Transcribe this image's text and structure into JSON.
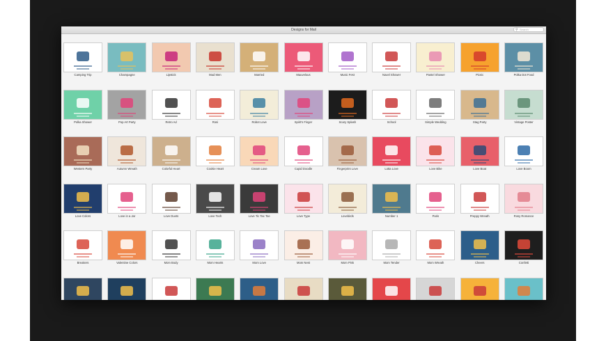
{
  "window": {
    "title": "Designs for Mail",
    "search_placeholder": "Search"
  },
  "templates": [
    {
      "name": "Camping Trip",
      "bg": "#ffffff",
      "accent": "#2e5c88"
    },
    {
      "name": "Champagne",
      "bg": "#79bcc0",
      "accent": "#e8c25a"
    },
    {
      "name": "Lipstick",
      "bg": "#f2c9b0",
      "accent": "#c7247a"
    },
    {
      "name": "Mad Men",
      "bg": "#e9e0cf",
      "accent": "#c8342b"
    },
    {
      "name": "Married",
      "bg": "#d4b078",
      "accent": "#ffffff"
    },
    {
      "name": "Mauvelous",
      "bg": "#ec5a78",
      "accent": "#ffffff"
    },
    {
      "name": "Music Fest",
      "bg": "#ffffff",
      "accent": "#a25cc7"
    },
    {
      "name": "Navel Shower",
      "bg": "#ffffff",
      "accent": "#c93a3a"
    },
    {
      "name": "Pastel Shower",
      "bg": "#f8efd0",
      "accent": "#e88bb0"
    },
    {
      "name": "Picnic",
      "bg": "#f6a22e",
      "accent": "#d33a2c"
    },
    {
      "name": "Polka Dot Food",
      "bg": "#5c8fa6",
      "accent": "#f2e9d6"
    },
    {
      "name": "Polka Shower",
      "bg": "#6fd1a8",
      "accent": "#ffffff"
    },
    {
      "name": "Pop Art Party",
      "bg": "#a3a3a3",
      "accent": "#e0447a"
    },
    {
      "name": "Retro Ad",
      "bg": "#ffffff",
      "accent": "#333333"
    },
    {
      "name": "Rosi",
      "bg": "#ffffff",
      "accent": "#d7483a"
    },
    {
      "name": "Robot Love",
      "bg": "#f3edd9",
      "accent": "#3c7fa0"
    },
    {
      "name": "Spirit's Finger",
      "bg": "#b8a1c6",
      "accent": "#e0447a"
    },
    {
      "name": "Scary Splash",
      "bg": "#1c1c1c",
      "accent": "#e26a1f"
    },
    {
      "name": "School",
      "bg": "#ffffff",
      "accent": "#c93a3a"
    },
    {
      "name": "Simple Wedding",
      "bg": "#ffffff",
      "accent": "#666666"
    },
    {
      "name": "Stag Party",
      "bg": "#d8b88c",
      "accent": "#3c6e95"
    },
    {
      "name": "Vintage Poster",
      "bg": "#c6ddd0",
      "accent": "#5a8a6e"
    },
    {
      "name": "Western Party",
      "bg": "#a96b58",
      "accent": "#f3e1c2"
    },
    {
      "name": "Autumn Wreath",
      "bg": "#efe6db",
      "accent": "#b0572c"
    },
    {
      "name": "Colorful Heart",
      "bg": "#cdb08d",
      "accent": "#ffffff"
    },
    {
      "name": "Cookie Heart",
      "bg": "#ffffff",
      "accent": "#e27d3a"
    },
    {
      "name": "Cream Love",
      "bg": "#f9d8b8",
      "accent": "#e0447a"
    },
    {
      "name": "Cupid Doodle",
      "bg": "#ffffff",
      "accent": "#e0447a"
    },
    {
      "name": "Fingerprint Love",
      "bg": "#d9c2ae",
      "accent": "#9a5b3a"
    },
    {
      "name": "Lotta Love",
      "bg": "#e84a5f",
      "accent": "#ffffff"
    },
    {
      "name": "Love Bike",
      "bg": "#fbe3ea",
      "accent": "#d7483a"
    },
    {
      "name": "Love Boat",
      "bg": "#e8606a",
      "accent": "#2d4a76"
    },
    {
      "name": "Love Boom",
      "bg": "#ffffff",
      "accent": "#2d6aa6"
    },
    {
      "name": "Love Colors",
      "bg": "#213e6d",
      "accent": "#f2c04a"
    },
    {
      "name": "Love in a Jar",
      "bg": "#ffffff",
      "accent": "#e0447a"
    },
    {
      "name": "Love Duets",
      "bg": "#ffffff",
      "accent": "#5c3c2c"
    },
    {
      "name": "Love Tech",
      "bg": "#4a4a4a",
      "accent": "#ffffff"
    },
    {
      "name": "Love Tic Tac Toe",
      "bg": "#3a3a3a",
      "accent": "#e0447a"
    },
    {
      "name": "Love Type",
      "bg": "#fbe3ea",
      "accent": "#c93a3a"
    },
    {
      "name": "Lovebirds",
      "bg": "#f3ecd9",
      "accent": "#8a5b3a"
    },
    {
      "name": "Number 1",
      "bg": "#4f7a8e",
      "accent": "#f2c04a"
    },
    {
      "name": "Paris",
      "bg": "#ffffff",
      "accent": "#e0447a"
    },
    {
      "name": "Preppy Wreath",
      "bg": "#ffffff",
      "accent": "#c93a3a"
    },
    {
      "name": "Rosy Romance",
      "bg": "#f9dadf",
      "accent": "#e27d8a"
    },
    {
      "name": "Breakers",
      "bg": "#ffffff",
      "accent": "#d7483a"
    },
    {
      "name": "Valentine Colors",
      "bg": "#f08a50",
      "accent": "#ffffff"
    },
    {
      "name": "Mom Body",
      "bg": "#ffffff",
      "accent": "#333333"
    },
    {
      "name": "Mom Hearts",
      "bg": "#ffffff",
      "accent": "#3aa58a"
    },
    {
      "name": "Mom Love",
      "bg": "#ffffff",
      "accent": "#8a6cc0"
    },
    {
      "name": "Mom Nest",
      "bg": "#fbeee6",
      "accent": "#9a5b3a"
    },
    {
      "name": "Mom Pink",
      "bg": "#f2b8c2",
      "accent": "#ffffff"
    },
    {
      "name": "Mom Tender",
      "bg": "#ffffff",
      "accent": "#aaaaaa"
    },
    {
      "name": "Mom Wreath",
      "bg": "#ffffff",
      "accent": "#d7483a"
    },
    {
      "name": "Cheers",
      "bg": "#2c5e8a",
      "accent": "#f2c04a"
    },
    {
      "name": "Confetti",
      "bg": "#1e1e1e",
      "accent": "#e24a3a"
    },
    {
      "name": "",
      "bg": "#2f4660",
      "accent": "#f2c04a"
    },
    {
      "name": "",
      "bg": "#1f3f5e",
      "accent": "#f2c04a"
    },
    {
      "name": "",
      "bg": "#ffffff",
      "accent": "#c93a3a"
    },
    {
      "name": "",
      "bg": "#3c7a52",
      "accent": "#f2c04a"
    },
    {
      "name": "",
      "bg": "#2d5e88",
      "accent": "#e27d3a"
    },
    {
      "name": "",
      "bg": "#e8dcc4",
      "accent": "#c93a3a"
    },
    {
      "name": "",
      "bg": "#5a5a3a",
      "accent": "#f2c04a"
    },
    {
      "name": "",
      "bg": "#e4474a",
      "accent": "#ffffff"
    },
    {
      "name": "",
      "bg": "#d6d6d6",
      "accent": "#c93a3a"
    },
    {
      "name": "",
      "bg": "#f6b23a",
      "accent": "#c93a3a"
    },
    {
      "name": "",
      "bg": "#6ac0c9",
      "accent": "#e27d3a"
    },
    {
      "name": "",
      "bg": "#e2b6b0",
      "accent": "#c93a3a"
    }
  ]
}
